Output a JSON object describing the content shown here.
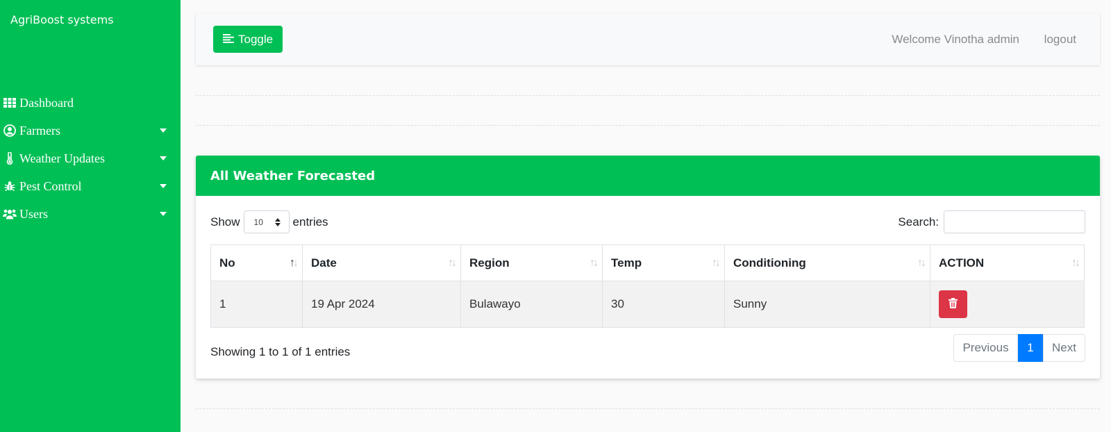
{
  "sidebar": {
    "brand": "AgriBoost systems",
    "items": [
      {
        "label": "Dashboard",
        "icon": "grid-icon",
        "has_submenu": false
      },
      {
        "label": "Farmers",
        "icon": "user-circle-icon",
        "has_submenu": true
      },
      {
        "label": "Weather Updates",
        "icon": "thermometer-icon",
        "has_submenu": true
      },
      {
        "label": "Pest Control",
        "icon": "bug-icon",
        "has_submenu": true
      },
      {
        "label": "Users",
        "icon": "users-icon",
        "has_submenu": true
      }
    ]
  },
  "topbar": {
    "toggle_label": "Toggle",
    "welcome": "Welcome Vinotha admin",
    "logout": "logout"
  },
  "card": {
    "title": "All Weather Forecasted",
    "length": {
      "prefix": "Show",
      "value": "10",
      "suffix": "entries"
    },
    "search_label": "Search:",
    "search_value": "",
    "columns": [
      "No",
      "Date",
      "Region",
      "Temp",
      "Conditioning",
      "ACTION"
    ],
    "rows": [
      {
        "no": "1",
        "date": "19 Apr 2024",
        "region": "Bulawayo",
        "temp": "30",
        "conditioning": "Sunny"
      }
    ],
    "info": "Showing 1 to 1 of 1 entries",
    "pagination": {
      "previous": "Previous",
      "current": "1",
      "next": "Next"
    }
  },
  "colors": {
    "brand_green": "#00bf55",
    "danger": "#dc3545",
    "primary": "#007bff"
  }
}
